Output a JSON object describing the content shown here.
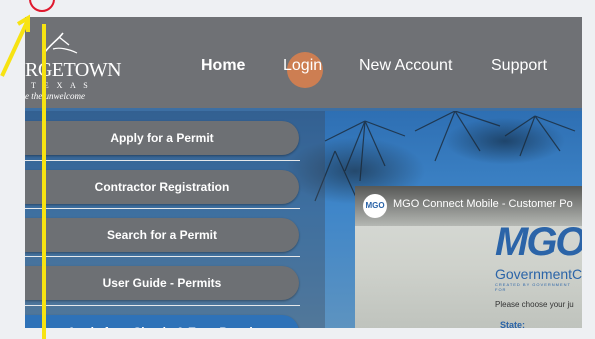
{
  "logo": {
    "text": "RGETOWN",
    "sub": "T E X A S",
    "tagline": "e the unwelcome"
  },
  "nav": {
    "home": "Home",
    "login": "Login",
    "new_account": "New Account",
    "support": "Support"
  },
  "sidebar": {
    "items": [
      {
        "label": "Apply for a Permit"
      },
      {
        "label": "Contractor Registration"
      },
      {
        "label": "Search for a Permit"
      },
      {
        "label": "User Guide - Permits"
      },
      {
        "label": "Apply for a Simple & Easy Permit"
      }
    ]
  },
  "video": {
    "avatar": "MGO",
    "title": "MGO Connect Mobile - Customer Po",
    "brand": "MGO",
    "gov_text": "GovernmentC",
    "gov_small": "CREATED BY GOVERNMENT FOR",
    "choose": "Please choose your ju",
    "state": "State:"
  },
  "colors": {
    "header": "#6f7175",
    "accent_blue": "#2e72b8",
    "pill_gray": "#6d7074",
    "click_marker": "#e88248",
    "annotation_yellow": "#f7e312",
    "annotation_red": "#e0192e"
  }
}
